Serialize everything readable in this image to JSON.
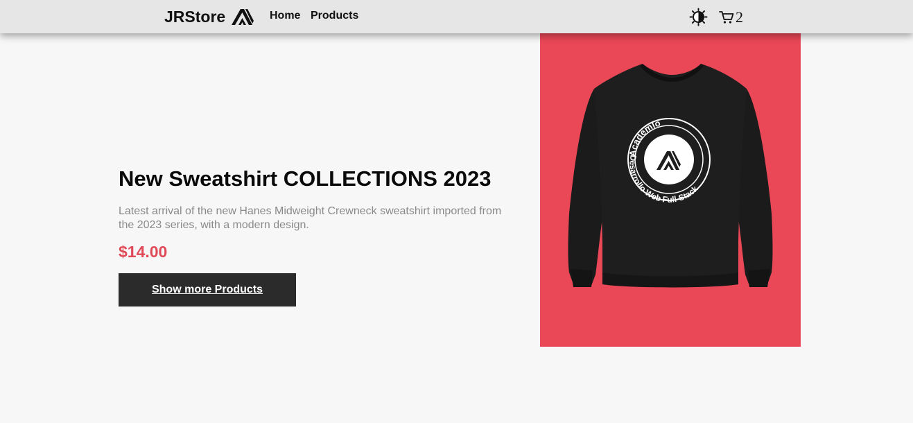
{
  "header": {
    "brand": "JRStore",
    "nav": [
      {
        "label": "Home"
      },
      {
        "label": "Products"
      }
    ],
    "theme_icon": "contrast-icon",
    "cart_icon": "cart-icon",
    "cart_count": "2"
  },
  "hero": {
    "title": "New Sweatshirt COLLECTIONS 2023",
    "description": "Latest arrival of the new Hanes Midweight Crewneck sweatshirt imported from the 2023 series, with a modern design.",
    "price": "$14.00",
    "button_label": "Show more Products"
  },
  "product_image": {
    "background": "#ea4757",
    "print_top": "Academlo",
    "print_bottom": "Desarrollo Web Full-Stack"
  },
  "colors": {
    "header_bg": "#e6e6e6",
    "page_bg": "#f7f7f7",
    "price": "#e04a58",
    "button_bg": "#2b2b2b",
    "description": "#8a8a8a"
  }
}
